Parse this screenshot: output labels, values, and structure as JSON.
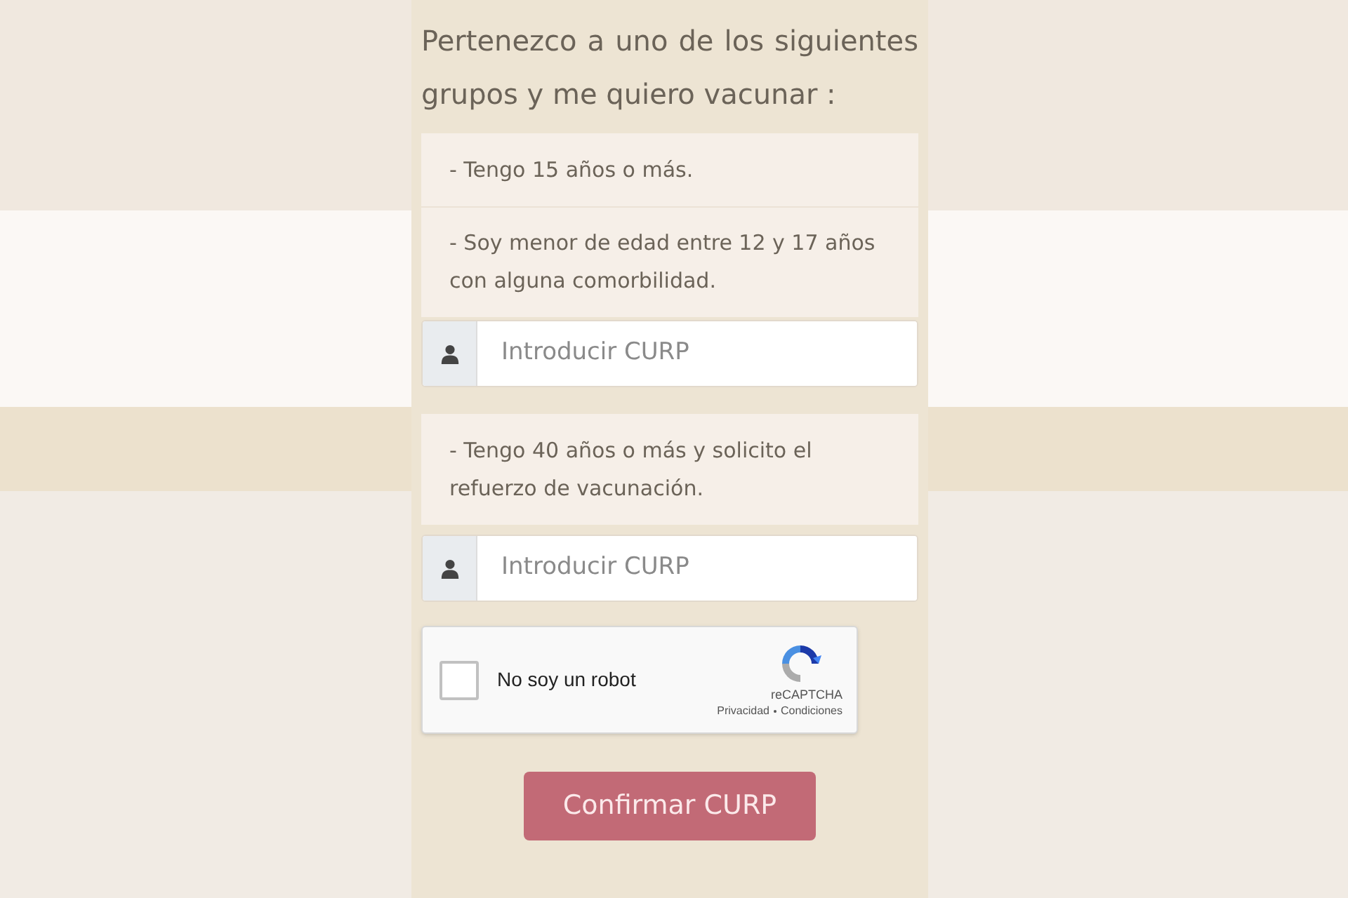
{
  "heading": "Pertenezco a uno de los siguientes grupos y me quiero vacunar :",
  "groups": [
    {
      "options": [
        "- Tengo 15 años o más.",
        "- Soy menor de edad entre 12 y 17 años con alguna comorbilidad."
      ],
      "input": {
        "placeholder": "Introducir CURP"
      }
    },
    {
      "options": [
        "- Tengo 40 años o más y solicito el refuerzo de vacunación."
      ],
      "input": {
        "placeholder": "Introducir CURP"
      }
    }
  ],
  "captcha": {
    "label": "No soy un robot",
    "checked": false,
    "brand": "reCAPTCHA",
    "links": [
      "Privacidad",
      "Condiciones"
    ]
  },
  "button": "Confirmar CURP"
}
